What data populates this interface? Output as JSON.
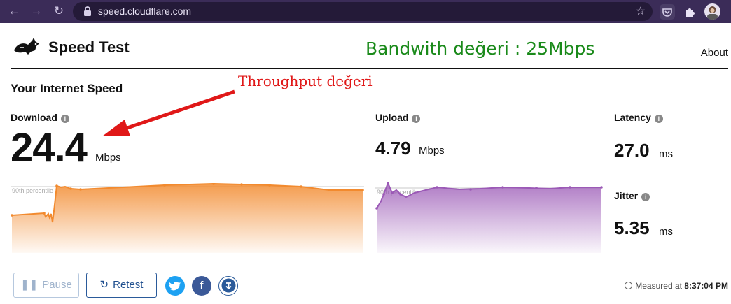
{
  "browser": {
    "url": "speed.cloudflare.com",
    "back_icon": "arrow-left-icon",
    "forward_icon": "arrow-right-icon",
    "reload_icon": "reload-icon"
  },
  "header": {
    "title": "Speed Test",
    "about_label": "About"
  },
  "annotations": {
    "bandwidth": "Bandwith değeri : 25Mbps",
    "throughput": "Throughput değeri"
  },
  "section_title": "Your Internet Speed",
  "download": {
    "label": "Download",
    "value": "24.4",
    "unit": "Mbps",
    "percentile_label": "90th percentile"
  },
  "upload": {
    "label": "Upload",
    "value": "4.79",
    "unit": "Mbps",
    "percentile_label": "90th percentile"
  },
  "latency": {
    "label": "Latency",
    "value": "27.0",
    "unit": "ms"
  },
  "jitter": {
    "label": "Jitter",
    "value": "5.35",
    "unit": "ms"
  },
  "buttons": {
    "pause_label": "Pause",
    "retest_label": "Retest"
  },
  "share": {
    "twitter_icon": "twitter-icon",
    "facebook_icon": "facebook-icon",
    "download_icon": "download-icon"
  },
  "measured": {
    "prefix": "Measured at",
    "time": "8:37:04 PM"
  },
  "colors": {
    "download": "#f28a2e",
    "upload": "#9b59b6",
    "chrome": "#3b2c58",
    "bandwidth_note": "#1a8a1a",
    "throughput_note": "#e01818"
  }
}
